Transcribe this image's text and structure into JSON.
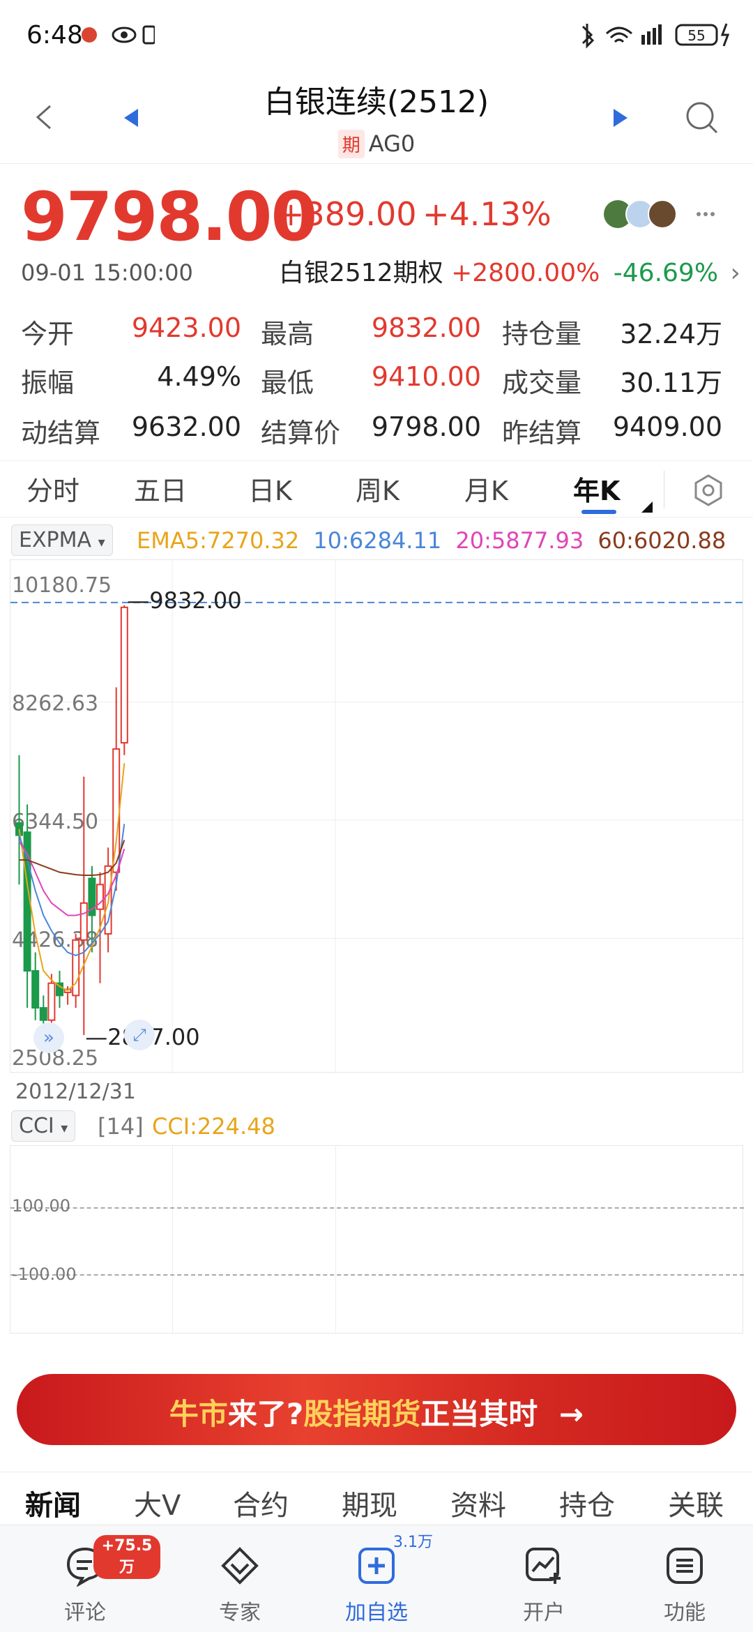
{
  "status_bar": {
    "time": "6:48",
    "battery": "55",
    "network": "4G"
  },
  "header": {
    "title": "白银连续(2512)",
    "badge": "期",
    "code": "AG0"
  },
  "quote": {
    "price": "9798.00",
    "change": "+389.00",
    "change_pct": "+4.13%",
    "timestamp": "09-01 15:00:00",
    "option_name": "白银2512期权",
    "option_pct1": "+2800.00%",
    "option_pct2": "-46.69%"
  },
  "stats": [
    {
      "label": "今开",
      "value": "9423.00",
      "tone": "red"
    },
    {
      "label": "最高",
      "value": "9832.00",
      "tone": "red"
    },
    {
      "label": "持仓量",
      "value": "32.24万",
      "tone": "dark"
    },
    {
      "label": "振幅",
      "value": "4.49%",
      "tone": "dark"
    },
    {
      "label": "最低",
      "value": "9410.00",
      "tone": "red"
    },
    {
      "label": "成交量",
      "value": "30.11万",
      "tone": "dark"
    },
    {
      "label": "动结算",
      "value": "9632.00",
      "tone": "dark"
    },
    {
      "label": "结算价",
      "value": "9798.00",
      "tone": "dark"
    },
    {
      "label": "昨结算",
      "value": "9409.00",
      "tone": "dark"
    }
  ],
  "tabs": [
    "分时",
    "五日",
    "日K",
    "周K",
    "月K",
    "年K"
  ],
  "active_tab": "年K",
  "indicator": {
    "name": "EXPMA",
    "ema5": "EMA5:7270.32",
    "ema10": "10:6284.11",
    "ema20": "20:5877.93",
    "ema60": "60:6020.88"
  },
  "cci": {
    "name": "CCI",
    "period": "[14]",
    "value": "CCI:224.48",
    "y_labels": [
      "100.00",
      "-100.00"
    ]
  },
  "chart_data": {
    "type": "candlestick",
    "y_tick_labels": [
      "10180.75",
      "8262.63",
      "6344.50",
      "4426.38",
      "2508.25"
    ],
    "ylim": [
      2508.25,
      10180.75
    ],
    "max_label": "9832.00",
    "min_label": "2857.00",
    "start_date": "2012/12/31",
    "candles": [
      {
        "o": 6300,
        "c": 6100,
        "h": 7400,
        "l": 5300
      },
      {
        "o": 6150,
        "c": 3900,
        "h": 6600,
        "l": 3300
      },
      {
        "o": 3900,
        "c": 3300,
        "h": 4200,
        "l": 3100
      },
      {
        "o": 3300,
        "c": 3100,
        "h": 3500,
        "l": 2950
      },
      {
        "o": 3100,
        "c": 3700,
        "h": 3850,
        "l": 3050
      },
      {
        "o": 3700,
        "c": 3500,
        "h": 3900,
        "l": 3300
      },
      {
        "o": 3550,
        "c": 3600,
        "h": 3650,
        "l": 3350
      },
      {
        "o": 3500,
        "c": 4400,
        "h": 4500,
        "l": 3300
      },
      {
        "o": 4400,
        "c": 5000,
        "h": 7050,
        "l": 2857
      },
      {
        "o": 5400,
        "c": 4800,
        "h": 5600,
        "l": 4200
      },
      {
        "o": 4900,
        "c": 5300,
        "h": 5500,
        "l": 3700
      },
      {
        "o": 4500,
        "c": 5600,
        "h": 5900,
        "l": 4200
      },
      {
        "o": 5500,
        "c": 7500,
        "h": 8500,
        "l": 5200
      },
      {
        "o": 7600,
        "c": 9798,
        "h": 9832,
        "l": 7400
      }
    ],
    "series": [
      {
        "name": "EMA5",
        "color": "#e8a41a",
        "values": [
          6200,
          5300,
          4500,
          3900,
          3750,
          3650,
          3580,
          3700,
          4000,
          4300,
          4600,
          5000,
          6000,
          7270
        ]
      },
      {
        "name": "10",
        "color": "#4a86d8",
        "values": [
          6100,
          5700,
          5200,
          4800,
          4550,
          4350,
          4200,
          4150,
          4200,
          4350,
          4500,
          4700,
          5300,
          6284
        ]
      },
      {
        "name": "20",
        "color": "#e045b8",
        "values": [
          6000,
          5800,
          5500,
          5200,
          5000,
          4900,
          4800,
          4800,
          4830,
          4900,
          5000,
          5150,
          5450,
          5878
        ]
      },
      {
        "name": "60",
        "color": "#8a3b1c",
        "values": [
          5700,
          5700,
          5650,
          5600,
          5550,
          5500,
          5480,
          5460,
          5450,
          5450,
          5460,
          5500,
          5650,
          6021
        ]
      }
    ],
    "up_color": "#e2392f",
    "down_color": "#1a9a4a"
  },
  "banner": {
    "part1": "牛市",
    "part2": "来了?",
    "part3": "股指期货",
    "part4": "正当其时",
    "arrow": "→"
  },
  "news_tabs": [
    "新闻",
    "大V",
    "合约",
    "期现",
    "资料",
    "持仓",
    "关联"
  ],
  "bottom_nav": [
    {
      "label": "评论",
      "badge": "+75.5万"
    },
    {
      "label": "专家",
      "badge": ""
    },
    {
      "label": "加自选",
      "badge": "3.1万"
    },
    {
      "label": "开户",
      "badge": ""
    },
    {
      "label": "功能",
      "badge": ""
    }
  ]
}
